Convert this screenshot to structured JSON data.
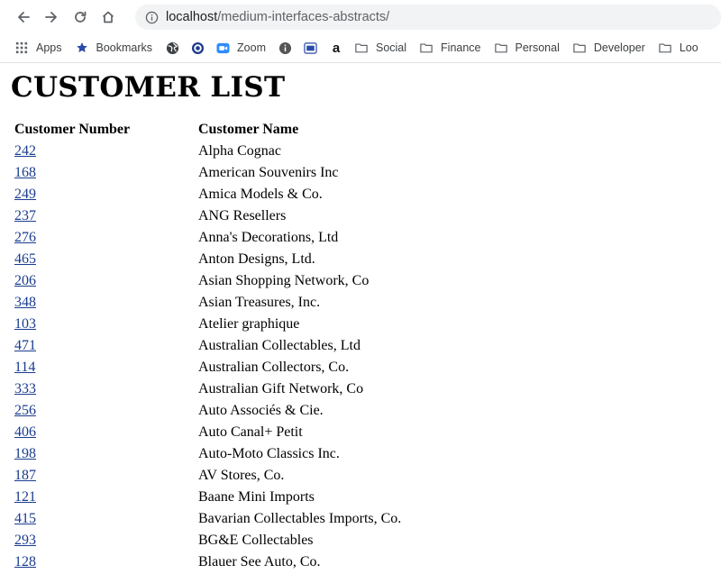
{
  "browser": {
    "url_host": "localhost",
    "url_path": "/medium-interfaces-abstracts/"
  },
  "bookmarks": {
    "apps": "Apps",
    "bookmarks": "Bookmarks",
    "zoom": "Zoom",
    "amazon_letter": "a",
    "social": "Social",
    "finance": "Finance",
    "personal": "Personal",
    "developer": "Developer",
    "loo": "Loo"
  },
  "page": {
    "title": "CUSTOMER LIST",
    "headers": {
      "number": "Customer Number",
      "name": "Customer Name"
    },
    "customers": [
      {
        "number": "242",
        "name": "Alpha Cognac"
      },
      {
        "number": "168",
        "name": "American Souvenirs Inc"
      },
      {
        "number": "249",
        "name": "Amica Models & Co."
      },
      {
        "number": "237",
        "name": "ANG Resellers"
      },
      {
        "number": "276",
        "name": "Anna's Decorations, Ltd"
      },
      {
        "number": "465",
        "name": "Anton Designs, Ltd."
      },
      {
        "number": "206",
        "name": "Asian Shopping Network, Co"
      },
      {
        "number": "348",
        "name": "Asian Treasures, Inc."
      },
      {
        "number": "103",
        "name": "Atelier graphique"
      },
      {
        "number": "471",
        "name": "Australian Collectables, Ltd"
      },
      {
        "number": "114",
        "name": "Australian Collectors, Co."
      },
      {
        "number": "333",
        "name": "Australian Gift Network, Co"
      },
      {
        "number": "256",
        "name": "Auto Associés & Cie."
      },
      {
        "number": "406",
        "name": "Auto Canal+ Petit"
      },
      {
        "number": "198",
        "name": "Auto-Moto Classics Inc."
      },
      {
        "number": "187",
        "name": "AV Stores, Co."
      },
      {
        "number": "121",
        "name": "Baane Mini Imports"
      },
      {
        "number": "415",
        "name": "Bavarian Collectables Imports, Co."
      },
      {
        "number": "293",
        "name": "BG&E Collectables"
      },
      {
        "number": "128",
        "name": "Blauer See Auto, Co."
      }
    ]
  },
  "colors": {
    "link": "#1a3c8f",
    "omnibox_bg": "#f1f3f4"
  }
}
